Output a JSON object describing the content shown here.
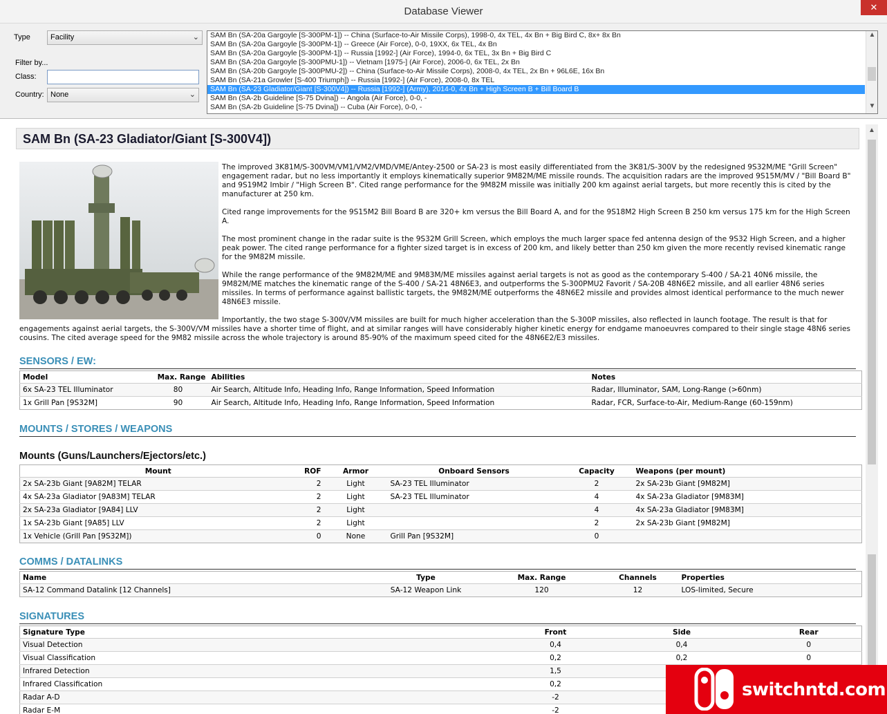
{
  "window": {
    "title": "Database Viewer",
    "close_glyph": "✕"
  },
  "filter": {
    "type_label": "Type",
    "type_value": "Facility",
    "filter_by_label": "Filter by...",
    "class_label": "Class:",
    "class_value": "",
    "country_label": "Country:",
    "country_value": "None"
  },
  "list": {
    "items": [
      "SAM Bn (SA-20a Gargoyle [S-300PM-1]) -- China (Surface-to-Air Missile Corps), 1998-0, 4x TEL, 4x Bn + Big Bird C, 8x+ 8x Bn",
      "SAM Bn (SA-20a Gargoyle [S-300PM-1]) -- Greece (Air Force), 0-0, 19XX, 6x TEL, 4x Bn",
      "SAM Bn (SA-20a Gargoyle [S-300PM-1]) -- Russia [1992-] (Air Force), 1994-0, 6x TEL, 3x Bn + Big Bird C",
      "SAM Bn (SA-20a Gargoyle [S-300PMU-1]) -- Vietnam [1975-] (Air Force), 2006-0, 6x TEL, 2x Bn",
      "SAM Bn (SA-20b Gargoyle [S-300PMU-2]) -- China (Surface-to-Air Missile Corps), 2008-0, 4x TEL, 2x Bn + 96L6E, 16x Bn",
      "SAM Bn (SA-21a Growler [S-400 Triumph]) -- Russia [1992-] (Air Force), 2008-0, 8x TEL",
      "SAM Bn (SA-23 Gladiator/Giant [S-300V4]) -- Russia [1992-] (Army), 2014-0, 4x Bn + High Screen B + Bill Board B",
      "SAM Bn (SA-2b Guideline [S-75 Dvina]) -- Angola (Air Force), 0-0, -",
      "SAM Bn (SA-2b Guideline [S-75 Dvina]) -- Cuba (Air Force), 0-0, -"
    ],
    "selected_index": 6
  },
  "detail": {
    "title": "SAM Bn (SA-23 Gladiator/Giant [S-300V4])",
    "paragraphs": [
      "The improved 3K81M/S-300VM/VM1/VM2/VMD/VME/Antey-2500 or SA-23 is most easily differentiated from the 3K81/S-300V by the redesigned 9S32M/ME \"Grill Screen\" engagement radar, but no less importantly it employs kinematically superior 9M82M/ME missile rounds. The acquisition radars are the improved 9S15M/MV / \"Bill Board B\" and 9S19M2 Imbir / \"High Screen B\". Cited range performance for the 9M82M missile was initially 200 km against aerial targets, but more recently this is cited by the manufacturer at 250 km.",
      "Cited range improvements for the 9S15M2 Bill Board B are 320+ km versus the Bill Board A, and for the 9S18M2 High Screen B 250 km versus 175 km for the High Screen A.",
      "The most prominent change in the radar suite is the 9S32M Grill Screen, which employs the much larger space fed antenna design of the 9S32 High Screen, and a higher peak power. The cited range performance for a fighter sized target is in excess of 200 km, and likely better than 250 km given the more recently revised kinematic range for the 9M82M missile.",
      "While the range performance of the 9M82M/ME and 9M83M/ME missiles against aerial targets is not as good as the contemporary S-400 / SA-21 40N6 missile, the 9M82M/ME matches the kinematic range of the S-400 / SA-21 48N6E3, and outperforms the S-300PMU2 Favorit / SA-20B 48N6E2 missile, and all earlier 48N6 series missiles. In terms of performance against ballistic targets, the 9M82M/ME outperforms the 48N6E2 missile and provides almost identical performance to the much newer 48N6E3 missile.",
      "Importantly, the two stage S-300V/VM missiles are built for much higher acceleration than the S-300P missiles, also reflected in launch footage. The result is that for engagements against aerial targets, the S-300V/VM missiles have a shorter time of flight, and at similar ranges will have considerably higher kinetic energy for endgame manoeuvres compared to their single stage 48N6 series cousins. The cited average speed for the 9M82 missile across the whole trajectory is around 85-90% of the maximum speed cited for the 48N6E2/E3 missiles."
    ]
  },
  "sensors": {
    "heading": "SENSORS / EW:",
    "columns": [
      "Model",
      "Max. Range",
      "Abilities",
      "Notes"
    ],
    "rows": [
      [
        "6x SA-23 TEL Illuminator",
        "80",
        "Air Search, Altitude Info, Heading Info, Range Information, Speed Information",
        "Radar, Illuminator, SAM, Long-Range (>60nm)"
      ],
      [
        "1x Grill Pan [9S32M]",
        "90",
        "Air Search, Altitude Info, Heading Info, Range Information, Speed Information",
        "Radar, FCR, Surface-to-Air, Medium-Range (60-159nm)"
      ]
    ]
  },
  "mounts_section": {
    "heading": "MOUNTS / STORES / WEAPONS",
    "sub_heading": "Mounts (Guns/Launchers/Ejectors/etc.)",
    "columns": [
      "Mount",
      "ROF",
      "Armor",
      "Onboard Sensors",
      "Capacity",
      "Weapons (per mount)"
    ],
    "rows": [
      [
        "2x SA-23b Giant [9A82M] TELAR",
        "2",
        "Light",
        "SA-23 TEL Illuminator",
        "2",
        "2x SA-23b Giant [9M82M]"
      ],
      [
        "4x SA-23a Gladiator [9A83M] TELAR",
        "2",
        "Light",
        "SA-23 TEL Illuminator",
        "4",
        "4x SA-23a Gladiator [9M83M]"
      ],
      [
        "2x SA-23a Gladiator [9A84] LLV",
        "2",
        "Light",
        "",
        "4",
        "4x SA-23a Gladiator [9M83M]"
      ],
      [
        "1x SA-23b Giant [9A85] LLV",
        "2",
        "Light",
        "",
        "2",
        "2x SA-23b Giant [9M82M]"
      ],
      [
        "1x Vehicle (Grill Pan [9S32M])",
        "0",
        "None",
        "Grill Pan [9S32M]",
        "0",
        ""
      ]
    ]
  },
  "comms": {
    "heading": "COMMS / DATALINKS",
    "columns": [
      "Name",
      "Type",
      "Max. Range",
      "Channels",
      "Properties"
    ],
    "rows": [
      [
        "SA-12 Command Datalink [12 Channels]",
        "SA-12 Weapon Link",
        "120",
        "12",
        "LOS-limited, Secure"
      ]
    ]
  },
  "signatures": {
    "heading": "SIGNATURES",
    "columns": [
      "Signature Type",
      "Front",
      "Side",
      "Rear"
    ],
    "rows": [
      [
        "Visual Detection",
        "0,4",
        "0,4",
        "0"
      ],
      [
        "Visual Classification",
        "0,2",
        "0,2",
        "0"
      ],
      [
        "Infrared Detection",
        "1,5",
        "",
        ""
      ],
      [
        "Infrared Classification",
        "0,2",
        "",
        ""
      ],
      [
        "Radar A-D",
        "-2",
        "",
        ""
      ],
      [
        "Radar E-M",
        "-2",
        "",
        ""
      ]
    ]
  },
  "watermark": {
    "text": "switchntd.com"
  },
  "colors": {
    "section_heading": "#3a8fb7",
    "selection": "#3399ff",
    "watermark_bg": "#e4000f"
  }
}
